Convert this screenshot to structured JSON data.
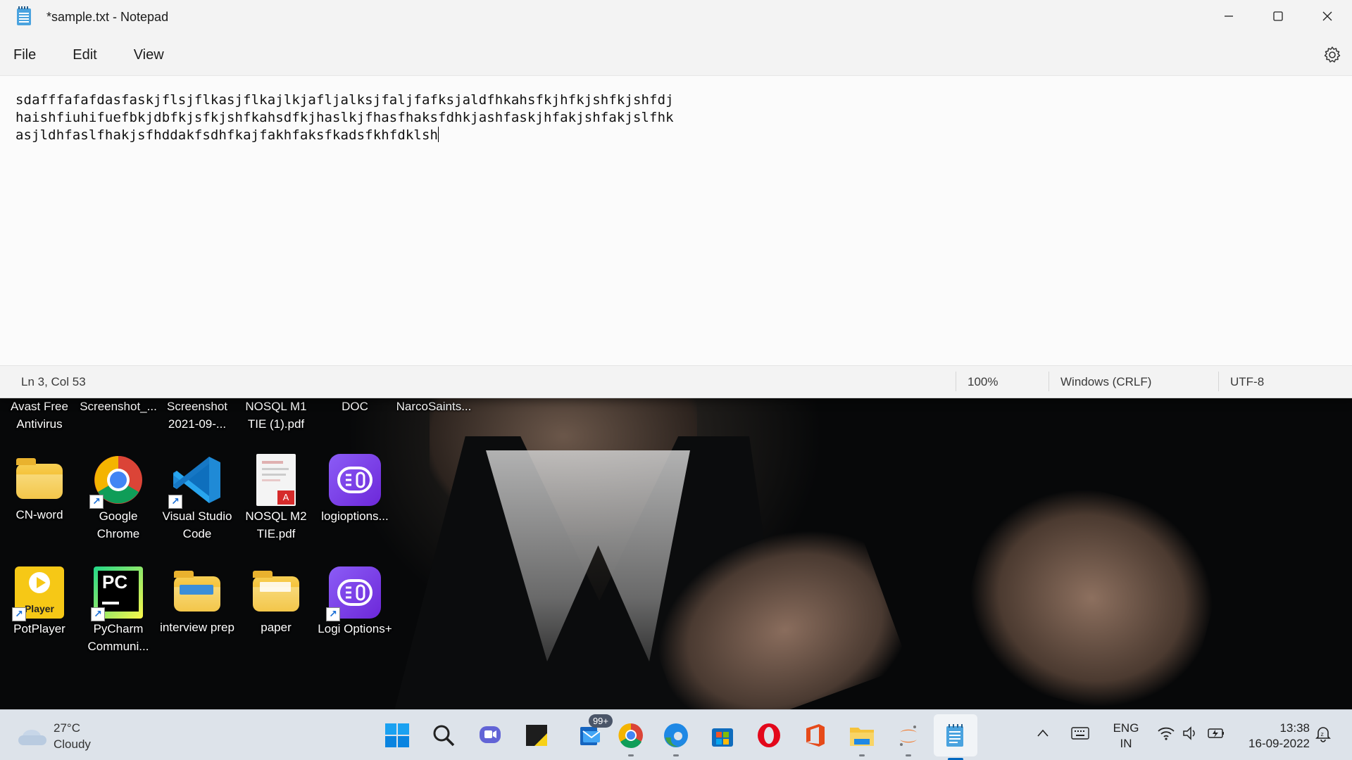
{
  "notepad": {
    "title": "*sample.txt - Notepad",
    "menu": [
      "File",
      "Edit",
      "View"
    ],
    "lines": [
      "sdafffafafdasfaskjflsjflkasjflkajlkjafljalksjfaljfafksjaldfhkahsfkjhfkjshfkjshfdj",
      "haishfiuhifuefbkjdbfkjsfkjshfkahsdfkjhaslkjfhasfhaksfdhkjashfaskjhfakjshfakjslfhk",
      "asjldhfaslfhakjsfhddakfsdhfkajfakhfaksfkadsfkhfdklsh"
    ],
    "status": {
      "position": "Ln 3, Col 53",
      "zoom": "100%",
      "line_ending": "Windows (CRLF)",
      "encoding": "UTF-8"
    }
  },
  "desktop": {
    "row1": [
      {
        "label": "Avast Free Antivirus"
      },
      {
        "label": "Screenshot_..."
      },
      {
        "label": "Screenshot 2021-09-..."
      },
      {
        "label": "NOSQL M1 TIE (1).pdf"
      },
      {
        "label": "DOC"
      },
      {
        "label": "NarcoSaints..."
      }
    ],
    "row2": [
      {
        "label": "CN-word",
        "icon": "folder-icon"
      },
      {
        "label": "Google Chrome",
        "icon": "chrome-icon"
      },
      {
        "label": "Visual Studio Code",
        "icon": "vscode-icon"
      },
      {
        "label": "NOSQL M2 TIE.pdf",
        "icon": "pdf-icon"
      },
      {
        "label": "logioptions...",
        "icon": "logi-options-icon"
      }
    ],
    "row3": [
      {
        "label": "PotPlayer",
        "icon": "potplayer-icon",
        "icon_text": "Player"
      },
      {
        "label": "PyCharm Communi...",
        "icon": "pycharm-icon",
        "icon_text": "PC"
      },
      {
        "label": "interview prep",
        "icon": "folder-icon"
      },
      {
        "label": "paper",
        "icon": "folder-icon"
      },
      {
        "label": "Logi Options+",
        "icon": "logi-options-icon"
      }
    ]
  },
  "taskbar": {
    "weather": {
      "temp": "27°C",
      "condition": "Cloudy"
    },
    "mail_badge": "99+",
    "language": {
      "line1": "ENG",
      "line2": "IN"
    },
    "clock": {
      "time": "13:38",
      "date": "16-09-2022"
    }
  },
  "colors": {
    "accent": "#0067c0",
    "taskbar_bg": "#dde3ea",
    "notepad_bg": "#f9f9f9"
  }
}
